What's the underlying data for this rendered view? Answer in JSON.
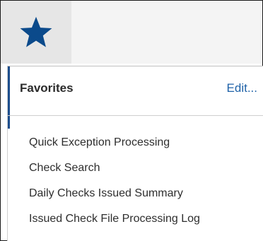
{
  "colors": {
    "star": "#0b4a8b",
    "edit_link": "#1f62a8",
    "accent": "#1c4d8c"
  },
  "toolbar": {
    "favorites_icon": "star-icon"
  },
  "favorites_menu": {
    "title": "Favorites",
    "edit_label": "Edit...",
    "items": [
      {
        "label": "Quick Exception Processing"
      },
      {
        "label": "Check Search"
      },
      {
        "label": "Daily Checks Issued Summary"
      },
      {
        "label": "Issued Check File Processing Log"
      }
    ]
  }
}
